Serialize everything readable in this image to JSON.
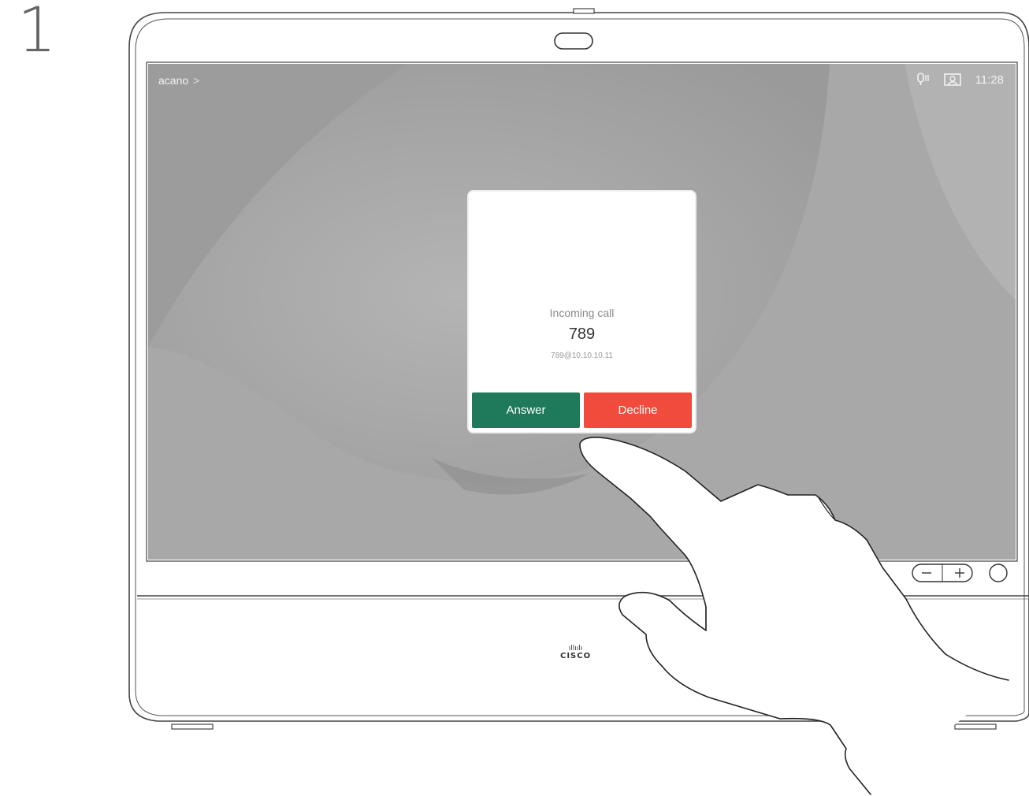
{
  "step": {
    "number": "1"
  },
  "screen": {
    "header_left": {
      "label": "acano",
      "chevron": ">"
    },
    "header_right": {
      "mic_icon": "microphone-status-icon",
      "selfview_icon": "selfview-icon",
      "time": "11:28"
    }
  },
  "incoming_call": {
    "title": "Incoming call",
    "number": "789",
    "address": "789@10.10.10.11",
    "answer_label": "Answer",
    "decline_label": "Decline"
  },
  "device_controls": {
    "volume_minus": "−",
    "volume_plus": "+",
    "home_icon": "home-button-icon"
  },
  "brand": {
    "name": "CISCO",
    "mark": "ıllıılı"
  },
  "colors": {
    "answer": "#1e7a5a",
    "decline": "#f04b3c",
    "screen_bg": "#9d9d9d"
  }
}
